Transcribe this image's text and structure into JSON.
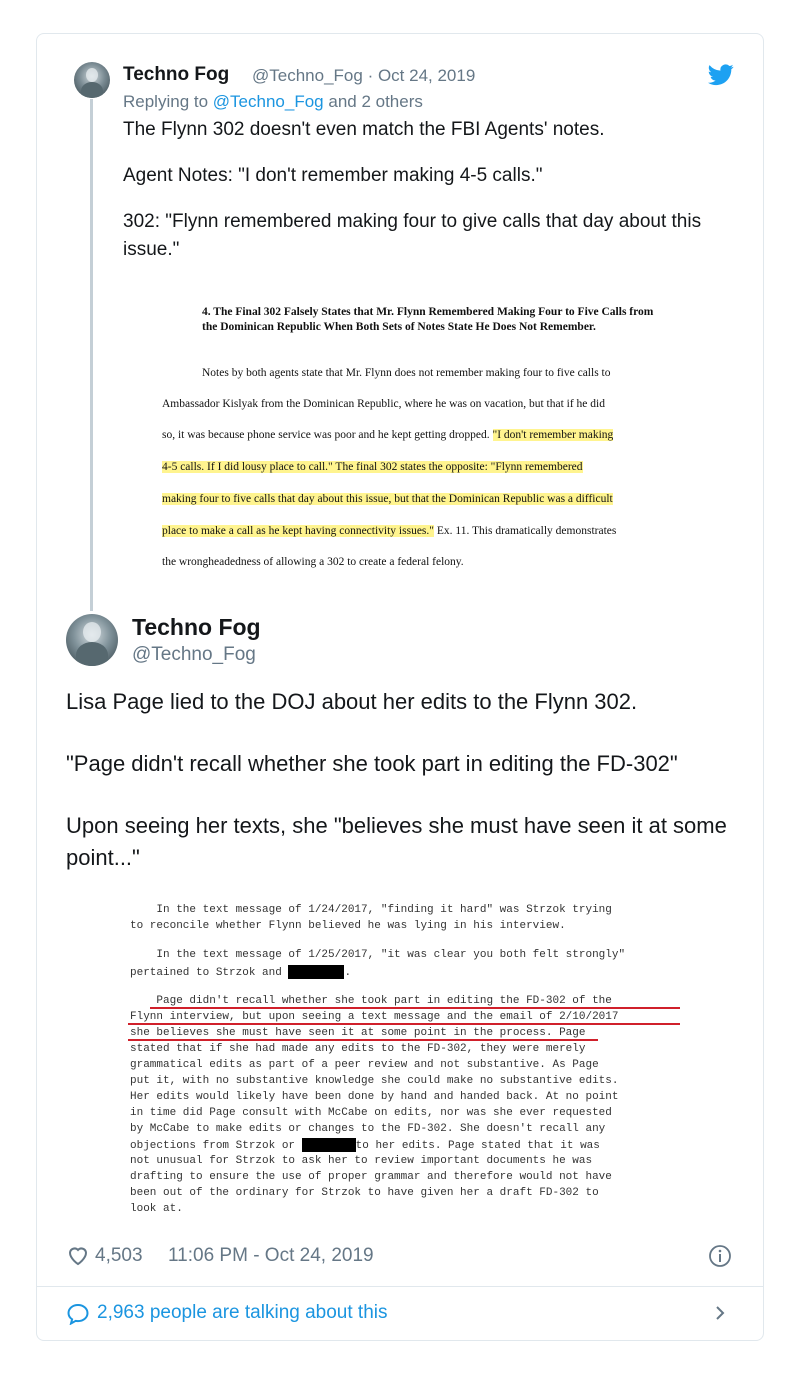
{
  "parent_tweet": {
    "author_name": "Techno Fog",
    "author_handle": "@Techno_Fog",
    "date": "· Oct 24, 2019",
    "replying_prefix": "Replying to",
    "replying_to": "@Techno_Fog",
    "replying_suffix": "and 2 others",
    "paragraphs": [
      "The Flynn 302 doesn't even match the FBI Agents' notes.",
      "Agent Notes: \"I don't remember making 4-5 calls.\"",
      "302: \"Flynn remembered making four to give calls that day about this issue.\""
    ],
    "document": {
      "heading": "4. The Final 302 Falsely States that Mr. Flynn Remembered Making Four to Five Calls from the Dominican Republic When Both Sets of Notes State He Does Not Remember.",
      "line1": "Notes by both agents state that Mr. Flynn does not remember making four to five calls to",
      "line2": "Ambassador Kislyak from the Dominican Republic, where he was on vacation, but that if he did",
      "line3_plain": "so, it was because phone service was poor and he kept getting dropped.",
      "line3_hl": "\"I don't remember making",
      "line4_hl": "4-5 calls. If I did lousy place to call.\"  The final 302 states the opposite: \"Flynn remembered",
      "line5_hl": "making four to five calls that day about this issue, but that the Dominican Republic was a difficult",
      "line6_hl": "place to make a call as he kept having connectivity issues.\"",
      "line6_plain": "Ex. 11. This dramatically demonstrates",
      "line7": "the wrongheadedness of allowing a 302 to create a federal felony."
    }
  },
  "main_tweet": {
    "author_name": "Techno Fog",
    "author_handle": "@Techno_Fog",
    "paragraphs": [
      "Lisa Page lied to the DOJ about her edits to the Flynn 302.",
      "\"Page didn't recall whether she took part in editing the FD-302\"",
      "Upon seeing her texts, she \"believes she must have seen it at some point...\""
    ],
    "document": {
      "l1": "    In the text message of 1/24/2017, \"finding it hard\" was Strzok trying",
      "l2": "to reconcile whether Flynn believed he was lying in his interview.",
      "l3": "    In the text message of 1/25/2017, \"it was clear you both felt strongly\"",
      "l4": "pertained to Strzok and",
      "l5": "    Page didn't recall whether she took part in editing the FD-302 of the",
      "l6": "Flynn interview, but upon seeing a text message and the email of 2/10/2017",
      "l7a": "she believes she must have seen it at some point in the process.",
      "l7b": " Page",
      "l8": "stated that if she had made any edits to the FD-302, they were merely",
      "l9": "grammatical edits as part of a peer review and not substantive. As Page",
      "l10": "put it, with no substantive knowledge she could make no substantive edits.",
      "l11": "Her edits would likely have been done by hand and handed back. At no point",
      "l12": "in time did Page consult with McCabe on edits, nor was she ever requested",
      "l13": "by McCabe to make edits or changes to the FD-302. She doesn't recall any",
      "l14a": "objections from Strzok or",
      "l14b": "to her edits. Page stated that it was",
      "l15": "not unusual for Strzok to ask her to review important documents he was",
      "l16": "drafting to ensure the use of proper grammar and therefore would not have",
      "l17": "been out of the ordinary for Strzok to have given her a draft FD-302 to",
      "l18": "look at."
    },
    "likes": "4,503",
    "timestamp": "11:06 PM - Oct 24, 2019",
    "talking": "2,963 people are talking about this"
  },
  "colors": {
    "link_blue": "#1b95e0",
    "secondary_gray": "#657786",
    "highlight_yellow": "#fff48f",
    "annotation_red": "#d0202b"
  },
  "icons": [
    "twitter-bird-icon",
    "heart-icon",
    "info-icon",
    "speech-bubble-icon",
    "chevron-right-icon"
  ]
}
